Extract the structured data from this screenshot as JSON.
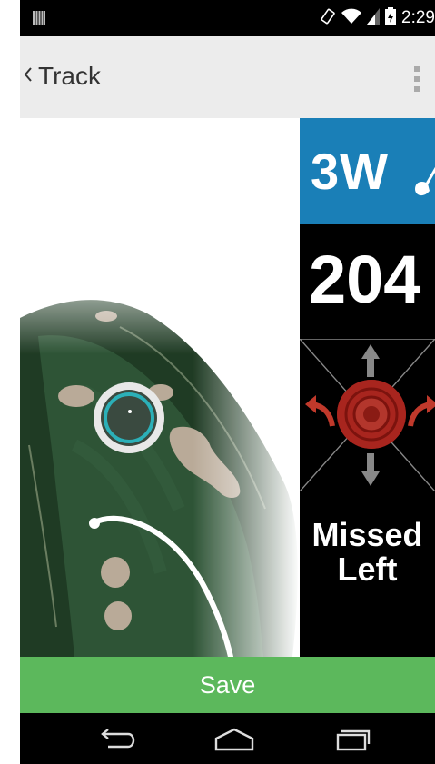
{
  "status_bar": {
    "time": "2:29",
    "icons": [
      "notification-icon",
      "rotate-icon",
      "wifi-icon",
      "signal-icon",
      "battery-icon"
    ]
  },
  "action_bar": {
    "back_label": "Track",
    "back_icon": "chevron-left-icon",
    "overflow_icon": "overflow-menu-icon"
  },
  "map": {
    "hole_features": [
      "fairway",
      "rough",
      "bunkers",
      "target-ring",
      "shot-path"
    ]
  },
  "shot": {
    "club": "3W",
    "club_icon": "golf-club-icon",
    "distance": "204",
    "result_line1": "Missed",
    "result_line2": "Left",
    "direction_icons": [
      "arrow-up-icon",
      "arrow-down-icon",
      "curve-left-icon",
      "curve-right-icon",
      "target-icon"
    ]
  },
  "save": {
    "label": "Save"
  },
  "nav_bar": {
    "icons": [
      "back-icon",
      "home-icon",
      "recents-icon"
    ]
  },
  "colors": {
    "club_panel": "#1a7fb7",
    "save_button": "#5cb85c",
    "target_red": "#b8231c",
    "action_bar": "#ececec"
  }
}
